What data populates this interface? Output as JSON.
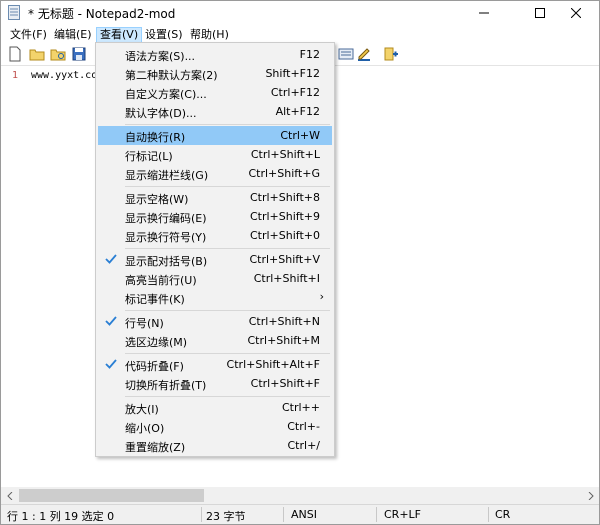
{
  "window": {
    "title": "* 无标题 - Notepad2-mod"
  },
  "menubar": {
    "items": [
      "文件(F)",
      "编辑(E)",
      "查看(V)",
      "设置(S)",
      "帮助(H)"
    ]
  },
  "editor": {
    "line_number": "1",
    "line_text": "www.yyxt.co"
  },
  "view_menu": {
    "items": [
      {
        "label": "语法方案(S)...",
        "shortcut": "F12"
      },
      {
        "label": "第二种默认方案(2)",
        "shortcut": "Shift+F12"
      },
      {
        "label": "自定义方案(C)...",
        "shortcut": "Ctrl+F12"
      },
      {
        "label": "默认字体(D)...",
        "shortcut": "Alt+F12"
      },
      {
        "label": "自动换行(R)",
        "shortcut": "Ctrl+W"
      },
      {
        "label": "行标记(L)",
        "shortcut": "Ctrl+Shift+L"
      },
      {
        "label": "显示缩进栏线(G)",
        "shortcut": "Ctrl+Shift+G"
      },
      {
        "label": "显示空格(W)",
        "shortcut": "Ctrl+Shift+8"
      },
      {
        "label": "显示换行编码(E)",
        "shortcut": "Ctrl+Shift+9"
      },
      {
        "label": "显示换行符号(Y)",
        "shortcut": "Ctrl+Shift+0"
      },
      {
        "label": "显示配对括号(B)",
        "shortcut": "Ctrl+Shift+V",
        "checked": true
      },
      {
        "label": "高亮当前行(U)",
        "shortcut": "Ctrl+Shift+I"
      },
      {
        "label": "标记事件(K)",
        "shortcut": "",
        "submenu": true
      },
      {
        "label": "行号(N)",
        "shortcut": "Ctrl+Shift+N",
        "checked": true
      },
      {
        "label": "选区边缘(M)",
        "shortcut": "Ctrl+Shift+M"
      },
      {
        "label": "代码折叠(F)",
        "shortcut": "Ctrl+Shift+Alt+F",
        "checked": true
      },
      {
        "label": "切换所有折叠(T)",
        "shortcut": "Ctrl+Shift+F"
      },
      {
        "label": "放大(I)",
        "shortcut": "Ctrl++"
      },
      {
        "label": "缩小(O)",
        "shortcut": "Ctrl+-"
      },
      {
        "label": "重置缩放(Z)",
        "shortcut": "Ctrl+/"
      }
    ],
    "highlighted_label": "自动换行(R)"
  },
  "statusbar": {
    "position": "行 1 : 1   列 19   选定 0",
    "size": "23 字节",
    "encoding": "ANSI",
    "line_endings": "CR+LF",
    "overtype": "CR"
  },
  "colors": {
    "menu_highlight": "#91c9f7",
    "open_menu_bg": "#cce8ff",
    "line_number": "#c0504d",
    "check_blue": "#2a7fd4"
  }
}
